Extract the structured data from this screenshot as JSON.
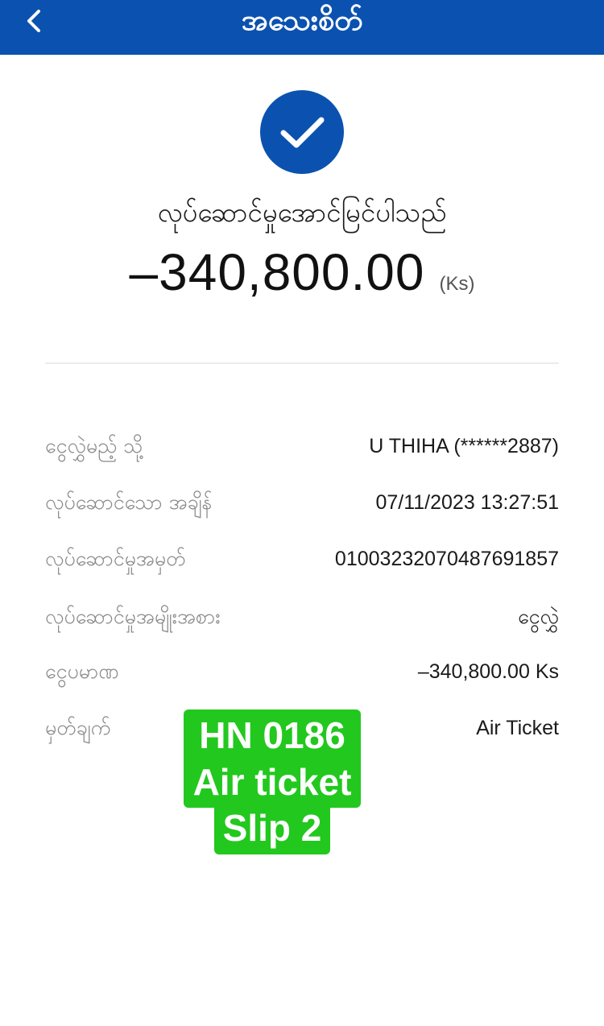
{
  "header": {
    "title": "အသေးစိတ်",
    "back_icon": "chevron-left-icon"
  },
  "status": {
    "icon": "checkmark-icon",
    "text": "လုပ်ဆောင်မှုအောင်မြင်ပါသည်"
  },
  "amount": {
    "value": "–340,800.00",
    "unit": "(Ks)"
  },
  "details": [
    {
      "label": "ငွေလွှဲမည့် သို့",
      "value": "U THIHA (******2887)"
    },
    {
      "label": "လုပ်ဆောင်သော အချိန်",
      "value": "07/11/2023 13:27:51"
    },
    {
      "label": "လုပ်ဆောင်မှုအမှတ်",
      "value": "01003232070487691857"
    },
    {
      "label": "လုပ်ဆောင်မှုအမျိုးအစား",
      "value": "ငွေလွှဲ"
    },
    {
      "label": "ငွေပမာဏ",
      "value": "–340,800.00 Ks"
    },
    {
      "label": "မှတ်ချက်",
      "value": "Air Ticket"
    }
  ],
  "sticker": {
    "lines": [
      "HN 0186",
      "Air ticket",
      "Slip 2"
    ]
  },
  "colors": {
    "brand": "#0b52b0",
    "sticker": "#22c81e"
  }
}
